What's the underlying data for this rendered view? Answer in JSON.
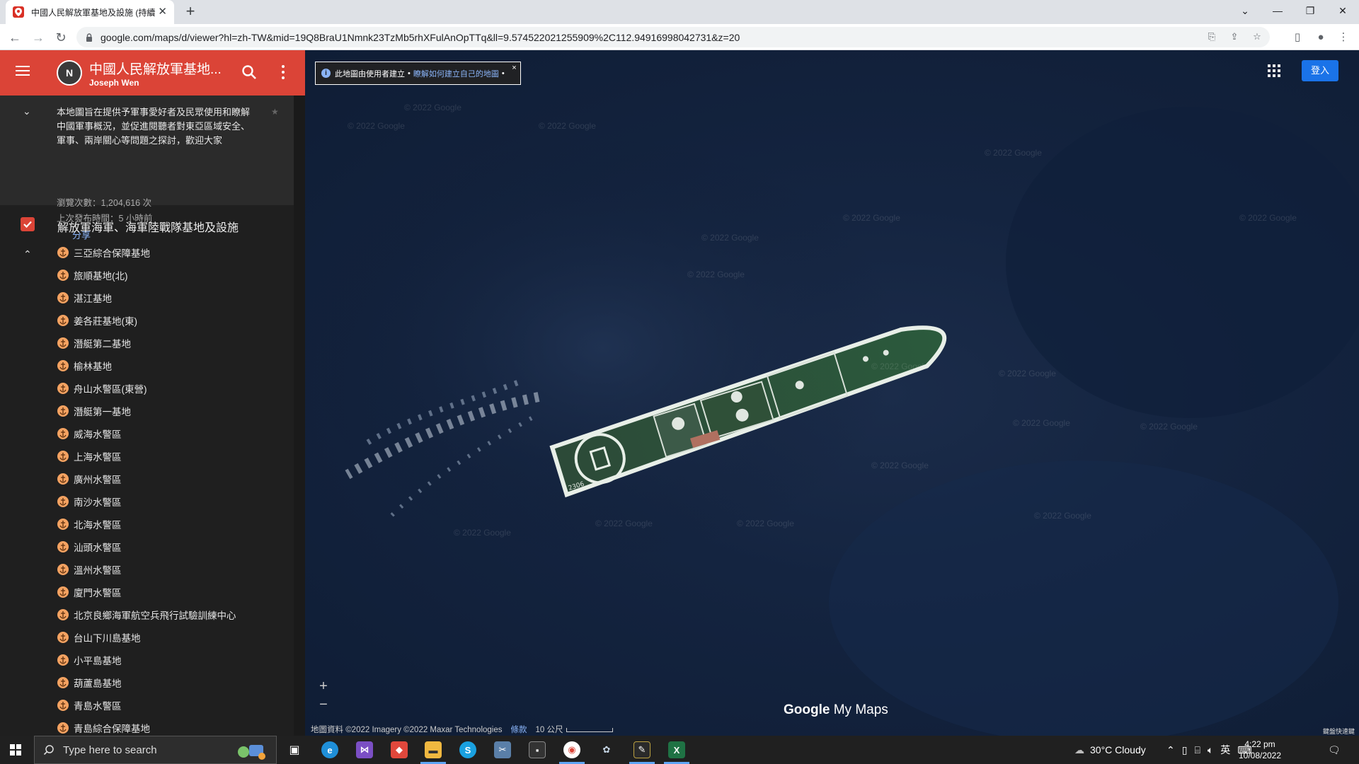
{
  "browser": {
    "tab_title": "中國人民解放軍基地及設施 (持續",
    "url": "google.com/maps/d/viewer?hl=zh-TW&mid=19Q8BraU1Nmnk23TzMb5rhXFulAnOpTTq&ll=9.574522021255909%2C112.94916998042731&z=20",
    "new_tab": "+"
  },
  "header": {
    "title": "中國人民解放軍基地...",
    "owner": "Joseph Wen"
  },
  "info": {
    "description": "本地圖旨在提供予軍事愛好者及民眾使用和瞭解中國軍事概況，並促進閱聽者對東亞區域安全、軍事、兩岸關心等問題之探討，歡迎大家",
    "views": "瀏覽次數：1,204,616 次",
    "last_published": "上次發布時間：5 小時前",
    "share": "分享"
  },
  "layer": {
    "name": "解放軍海軍、海軍陸戰隊基地及設施",
    "checked": true
  },
  "places": [
    "三亞綜合保障基地",
    "旅順基地(北)",
    "湛江基地",
    "姜各莊基地(東)",
    "潛艇第二基地",
    "榆林基地",
    "舟山水警區(東營)",
    "潛艇第一基地",
    "威海水警區",
    "上海水警區",
    "廣州水警區",
    "南沙水警區",
    "北海水警區",
    "汕頭水警區",
    "溫州水警區",
    "廈門水警區",
    "北京良鄉海軍航空兵飛行試驗訓練中心",
    "台山下川島基地",
    "小平島基地",
    "葫蘆島基地",
    "青島水警區",
    "青島綜合保障基地"
  ],
  "map": {
    "notice_text": "此地圖由使用者建立",
    "notice_link": "瞭解如何建立自己的地圖",
    "notice_sep": "•",
    "notice_end": "•",
    "notice_close": "×",
    "sign_in": "登入",
    "watermark": "© 2022 Google",
    "logo_google": "Google",
    "logo_mymaps": "My Maps",
    "attribution": "地圖資料 ©2022 Imagery ©2022 Maxar Technologies",
    "terms": "條款",
    "scale": "10 公尺",
    "shortcuts": "鍵盤快速鍵",
    "zoom_in": "+",
    "zoom_out": "−",
    "ship_marking": "2306"
  },
  "taskbar": {
    "search_placeholder": "Type here to search",
    "weather": "30°C  Cloudy",
    "ime": "英",
    "time": "4:22 pm",
    "date": "10/08/2022"
  },
  "colors": {
    "header_red": "#db4437",
    "panel_bg": "#1f1f1f",
    "sea": "#142440",
    "accent_blue": "#1a73e8"
  }
}
